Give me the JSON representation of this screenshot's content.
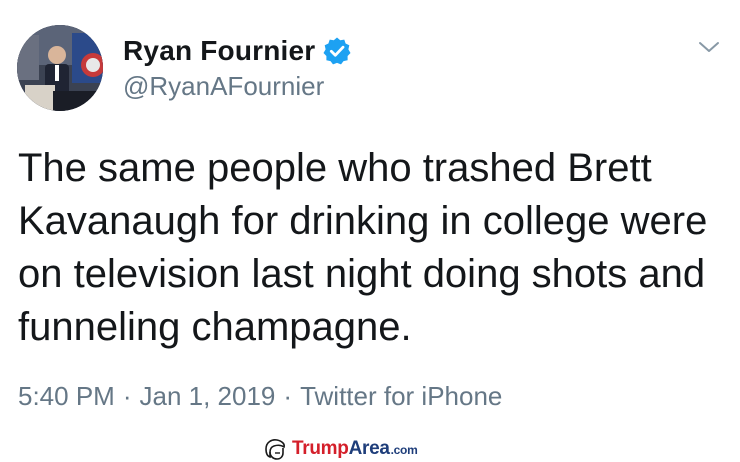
{
  "tweet": {
    "author": {
      "display_name": "Ryan Fournier",
      "handle": "@RyanAFournier",
      "verified": true,
      "avatar_icon": "profile-photo"
    },
    "menu_icon": "chevron-down-icon",
    "text": "The same people who trashed Brett\nKavanaugh for drinking in college were\non television last night doing shots and\nfunneling champagne.",
    "time": "5:40 PM",
    "separator": "·",
    "date": "Jan 1, 2019",
    "source": "Twitter for iPhone"
  },
  "watermark": {
    "icon": "trump-hair-icon",
    "part1": "Trump",
    "part2": "Area",
    "suffix": ".com"
  },
  "colors": {
    "verified_blue": "#1da1f2",
    "secondary_text": "#657786",
    "primary_text": "#14171a",
    "watermark_red": "#d41f2a",
    "watermark_navy": "#1e3d7a"
  }
}
